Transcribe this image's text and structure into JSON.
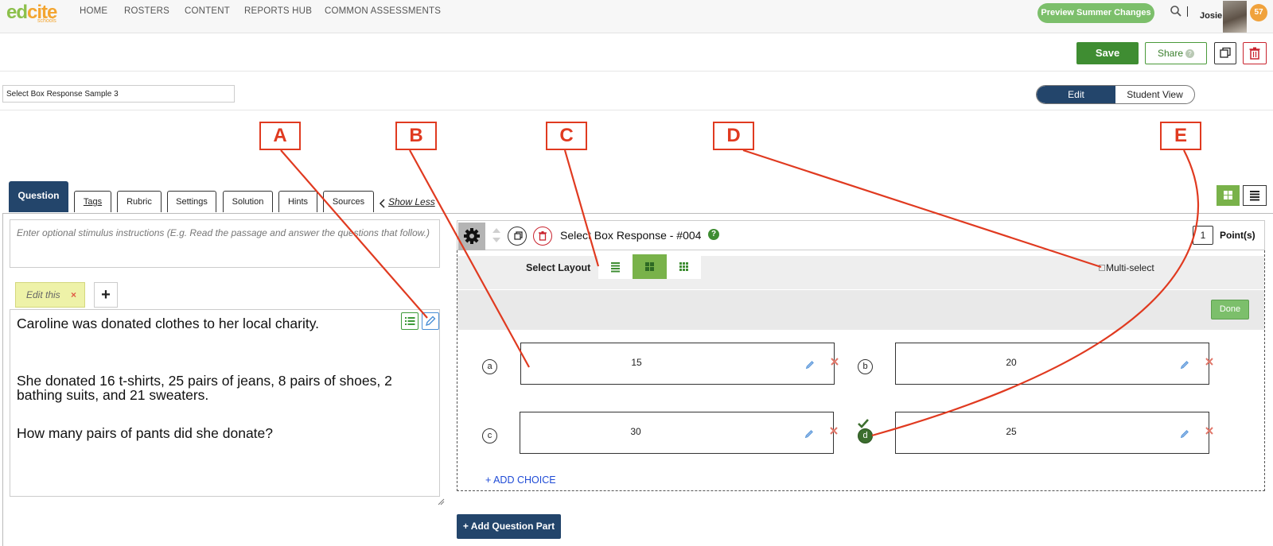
{
  "nav": {
    "logo_text_a": "ed",
    "logo_text_b": "cite",
    "logo_sub": "schools",
    "links": [
      "HOME",
      "ROSTERS",
      "CONTENT",
      "REPORTS HUB",
      "COMMON ASSESSMENTS"
    ],
    "preview_button": "Preview Summer Changes",
    "user_name": "Josie",
    "notification_count": "57"
  },
  "toolbar": {
    "save_label": "Save",
    "share_label": "Share",
    "share_help": "?"
  },
  "titlebar": {
    "title_value": "Select Box Response Sample 3",
    "view_edit": "Edit",
    "view_student": "Student View"
  },
  "callouts": [
    "A",
    "B",
    "C",
    "D",
    "E"
  ],
  "tabs": {
    "active": "Question",
    "items": [
      "Tags",
      "Rubric",
      "Settings",
      "Solution",
      "Hints",
      "Sources"
    ],
    "show_less": "Show Less"
  },
  "left": {
    "stimulus_placeholder": "Enter optional stimulus instructions (E.g. Read the passage and answer the questions that follow.)",
    "edit_tab": "Edit this",
    "edit_tab_close": "×",
    "add_tab": "+",
    "passage": [
      "Caroline was donated clothes to her local charity.",
      "She donated 16 t-shirts, 25 pairs of jeans, 8 pairs of shoes, 2 bathing suits, and 21 sweaters.",
      "How many pairs of pants did she donate?"
    ]
  },
  "question": {
    "title": "Select Box Response - #004",
    "help": "?",
    "points_value": "1",
    "points_label": "Point(s)",
    "layout_label": "Select Layout",
    "selected_layout": "grid-2x2",
    "multi_select_label": "Multi-select",
    "multi_select_checked": false,
    "done_label": "Done",
    "choices": [
      {
        "letter": "a",
        "value": "15",
        "correct": false
      },
      {
        "letter": "b",
        "value": "20",
        "correct": false
      },
      {
        "letter": "c",
        "value": "30",
        "correct": false
      },
      {
        "letter": "d",
        "value": "25",
        "correct": true
      }
    ],
    "add_choice": "+ ADD CHOICE",
    "add_part": "+ Add Question Part"
  },
  "colors": {
    "brand_green": "#3f8d32",
    "accent_green": "#79b24a",
    "navy": "#23456b",
    "callout_red": "#e03a20",
    "danger_red": "#c9232e"
  }
}
